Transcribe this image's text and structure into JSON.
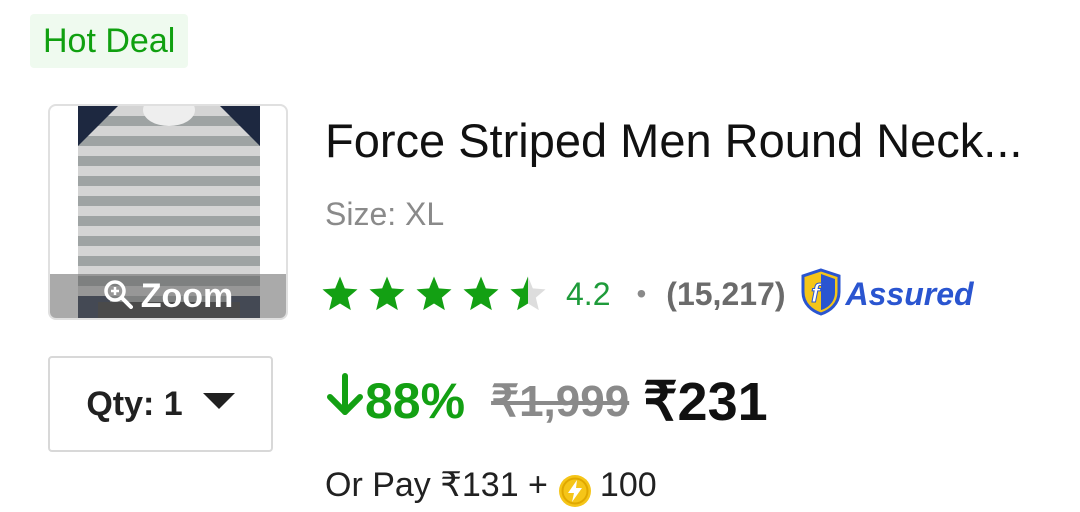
{
  "badge": {
    "label": "Hot Deal"
  },
  "product": {
    "zoom_label": "Zoom",
    "title": "Force Striped Men Round Neck...",
    "size": "Size: XL",
    "rating": {
      "stars_value": 4.2,
      "value": "4.2",
      "separator": "•",
      "count": "(15,217)",
      "assured_label": "Assured"
    },
    "qty_label": "Qty: 1",
    "pricing": {
      "discount": "88%",
      "mrp": "₹1,999",
      "price": "₹231"
    },
    "pay_option": {
      "prefix": "Or Pay ₹131 +",
      "coins": "100"
    }
  },
  "colors": {
    "badge_bg": "#effaef",
    "badge_text": "#10a010",
    "star_fill": "#13a013",
    "star_empty": "#dddddd",
    "discount_green": "#13a013",
    "assured_blue": "#2a55d0",
    "coin_yellow": "#f5c518"
  },
  "icons": {
    "zoom": "magnifier-plus-icon",
    "discount_arrow": "arrow-down-icon",
    "qty_caret": "caret-down-icon",
    "assured": "flipkart-assured-shield-icon",
    "coin": "supercoin-icon"
  }
}
